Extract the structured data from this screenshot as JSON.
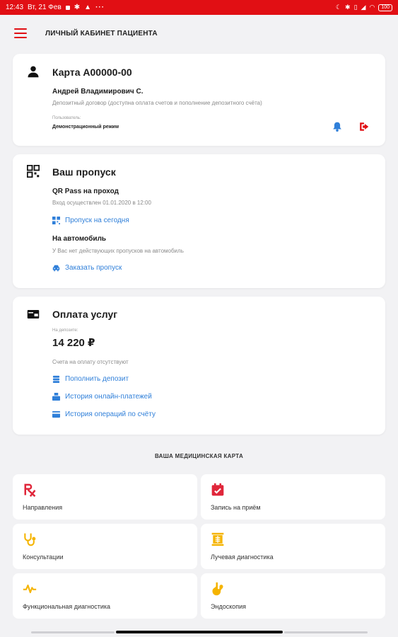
{
  "statusbar": {
    "time": "12:43",
    "date": "Вт, 21 Фев",
    "more": "···",
    "battery": "100"
  },
  "appbar": {
    "title": "ЛИЧНЫЙ КАБИНЕТ ПАЦИЕНТА"
  },
  "profile": {
    "title": "Карта А00000-00",
    "name": "Андрей Владимирович С.",
    "contract": "Депозитный договор (доступна оплата счетов и пополнение депозитного счёта)",
    "user_label": "Пользователь:",
    "user_value": "Демонстрационный режим"
  },
  "pass": {
    "title": "Ваш пропуск",
    "qr_title": "QR Pass на проход",
    "qr_entry": "Вход осуществлен 01.01.2020 в 12:00",
    "qr_link": "Пропуск на сегодня",
    "car_title": "На автомобиль",
    "car_text": "У Вас нет действующих пропусков на автомобиль",
    "car_link": "Заказать пропуск"
  },
  "payment": {
    "title": "Оплата услуг",
    "deposit_label": "На депозите:",
    "deposit_value": "14 220 ₽",
    "no_bills": "Счета на оплату отсутствуют",
    "links": [
      "Пополнить депозит",
      "История онлайн-платежей",
      "История операций по счёту"
    ]
  },
  "medcard": {
    "section_title": "ВАША МЕДИЦИНСКАЯ КАРТА",
    "tiles": [
      {
        "label": "Направления",
        "icon": "rx-icon"
      },
      {
        "label": "Запись на приём",
        "icon": "calendar-check-icon"
      },
      {
        "label": "Консультации",
        "icon": "stethoscope-icon"
      },
      {
        "label": "Лучевая диагностика",
        "icon": "xray-icon"
      },
      {
        "label": "Функциональная диагностика",
        "icon": "heartbeat-icon"
      },
      {
        "label": "Эндоскопия",
        "icon": "stomach-icon"
      }
    ]
  },
  "colors": {
    "brand_red": "#e10f14",
    "link_blue": "#2f7fd9",
    "tile_yellow": "#f5b400"
  }
}
